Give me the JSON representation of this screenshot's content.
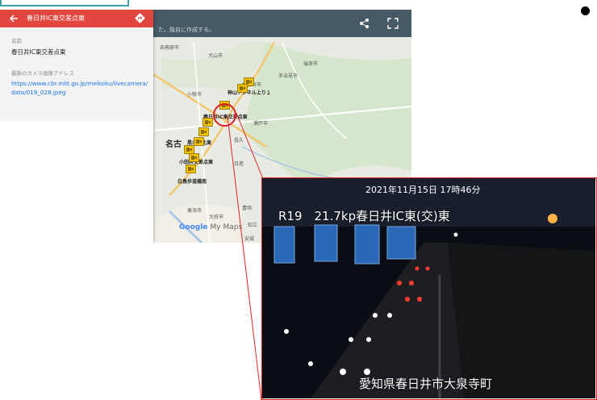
{
  "map": {
    "header_text": "た。独自に作成する。",
    "attribution": {
      "google": "Google",
      "my_maps": "My Maps"
    },
    "places": [
      "各務原市",
      "犬山市",
      "瑞浪市",
      "多治見市",
      "春日井市",
      "小牧市",
      "名古",
      "長久",
      "日進",
      "瀬戸市",
      "東海市",
      "大府市",
      "知立",
      "安城",
      "豊明"
    ],
    "camera_labels": [
      "神山トンネル上り１",
      "春日井IC東交差点東",
      "黒川橋北東",
      "小田井交差点東",
      "白鳥歩道橋南"
    ]
  },
  "panel": {
    "title": "春日井IC東交差点東",
    "name_label": "名前",
    "name_value": "春日井IC東交差点東",
    "url_label": "最新のカメラ画像アドレス",
    "url": "https://www.cbr.mlit.go.jp/meikoku/livecamera/data/019_028.jpeg"
  },
  "feed": {
    "timestamp": "2021年11月15日 17時46分",
    "road_label": "R19　21.7kp春日井IC東(交)東",
    "location": "愛知県春日井市大泉寺町"
  },
  "colors": {
    "panel_header": "#e2473f",
    "map_header": "#455a64",
    "camera_marker": "#f2c200",
    "highlight": "#e02020",
    "link": "#1a73e8"
  }
}
